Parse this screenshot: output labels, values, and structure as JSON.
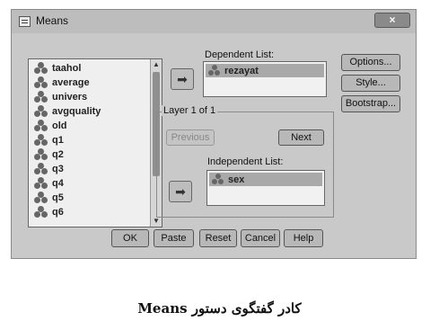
{
  "window": {
    "title": "Means",
    "close_glyph": "×"
  },
  "variables": [
    {
      "label": "taahol"
    },
    {
      "label": "average"
    },
    {
      "label": "univers"
    },
    {
      "label": "avgquality"
    },
    {
      "label": "old"
    },
    {
      "label": "q1"
    },
    {
      "label": "q2"
    },
    {
      "label": "q3"
    },
    {
      "label": "q4"
    },
    {
      "label": "q5"
    },
    {
      "label": "q6"
    }
  ],
  "dependent": {
    "label": "Dependent List:",
    "items": [
      "rezayat"
    ]
  },
  "layer": {
    "label": "Layer 1 of 1",
    "previous": "Previous",
    "next": "Next"
  },
  "independent": {
    "label": "Independent List:",
    "items": [
      "sex"
    ]
  },
  "side_buttons": {
    "options": "Options...",
    "style": "Style...",
    "bootstrap": "Bootstrap..."
  },
  "bottom_buttons": {
    "ok": "OK",
    "paste": "Paste",
    "reset": "Reset",
    "cancel": "Cancel",
    "help": "Help"
  },
  "caption": "کادر گفتگوی دستور Means",
  "icons": {
    "move_arrow": "arrow-right-icon",
    "variable": "scale-variable-icon"
  }
}
